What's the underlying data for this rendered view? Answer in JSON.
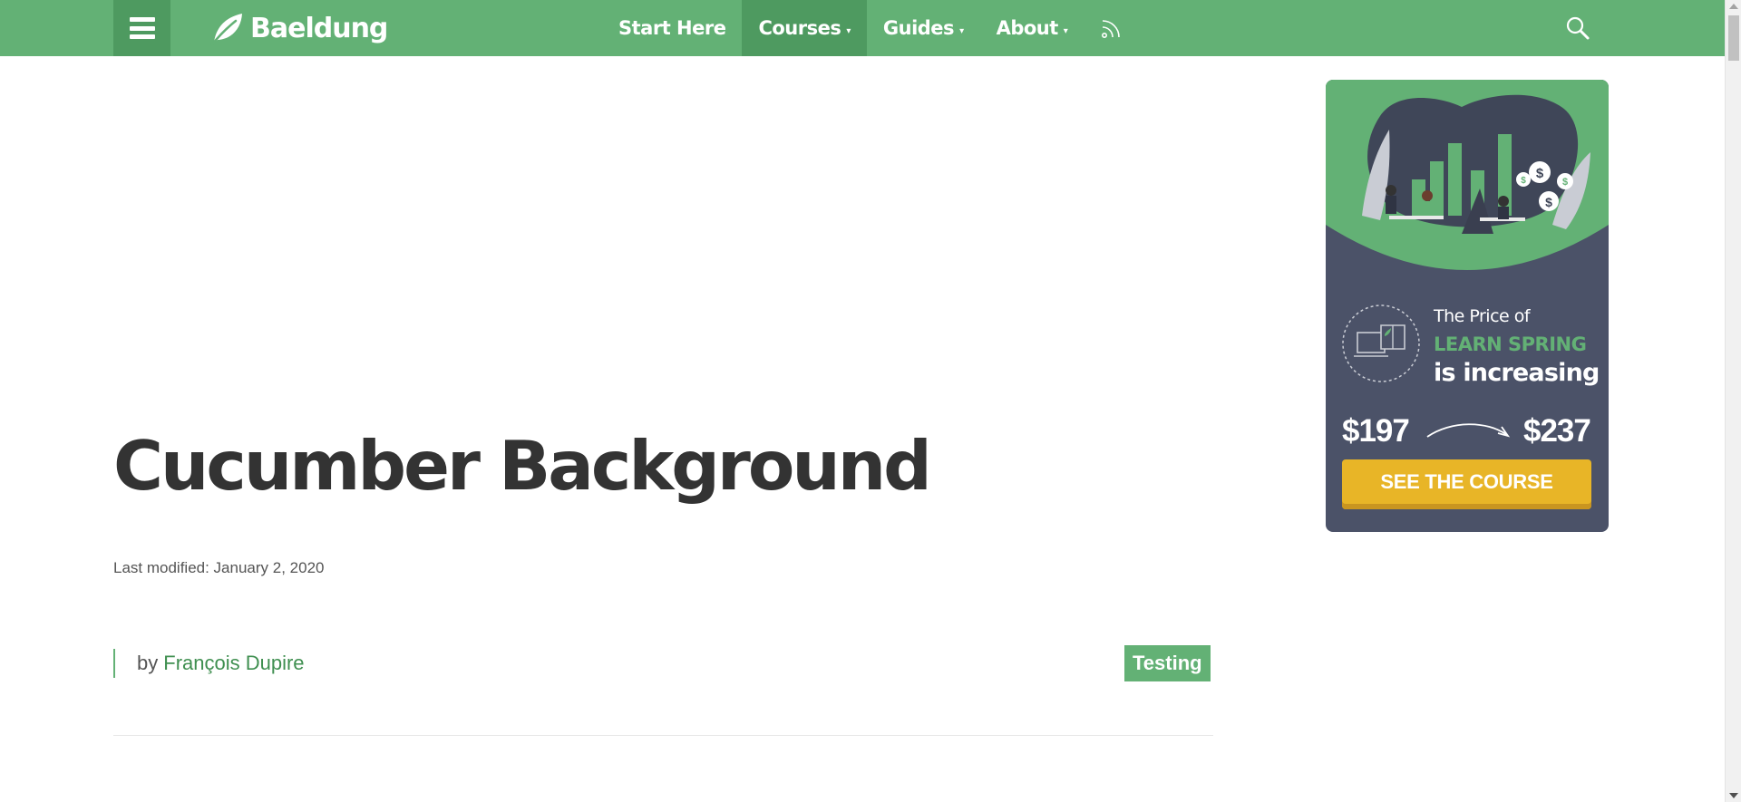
{
  "header": {
    "logo_text": "Baeldung",
    "nav": [
      {
        "label": "Start Here",
        "has_caret": false
      },
      {
        "label": "Courses",
        "has_caret": true,
        "active": true
      },
      {
        "label": "Guides",
        "has_caret": true
      },
      {
        "label": "About",
        "has_caret": true
      }
    ],
    "caret": "▾",
    "icons": [
      "hamburger-menu-icon",
      "leaf-logo-icon",
      "rss-feed-icon",
      "search-icon"
    ]
  },
  "article": {
    "title": "Cucumber Background",
    "last_modified": "Last modified: January 2, 2020",
    "by": "by",
    "author": "François Dupire",
    "category_tag": "Testing"
  },
  "ad": {
    "line1": "The Price of",
    "line2": "LEARN SPRING",
    "line3": "is increasing",
    "price_old": "$197",
    "price_new": "$237",
    "cta": "SEE THE COURSE"
  },
  "colors": {
    "brand_green": "#63b175",
    "dark_green": "#4e9a60",
    "ad_bg": "#4b5268",
    "cta_yellow": "#e8b527"
  }
}
